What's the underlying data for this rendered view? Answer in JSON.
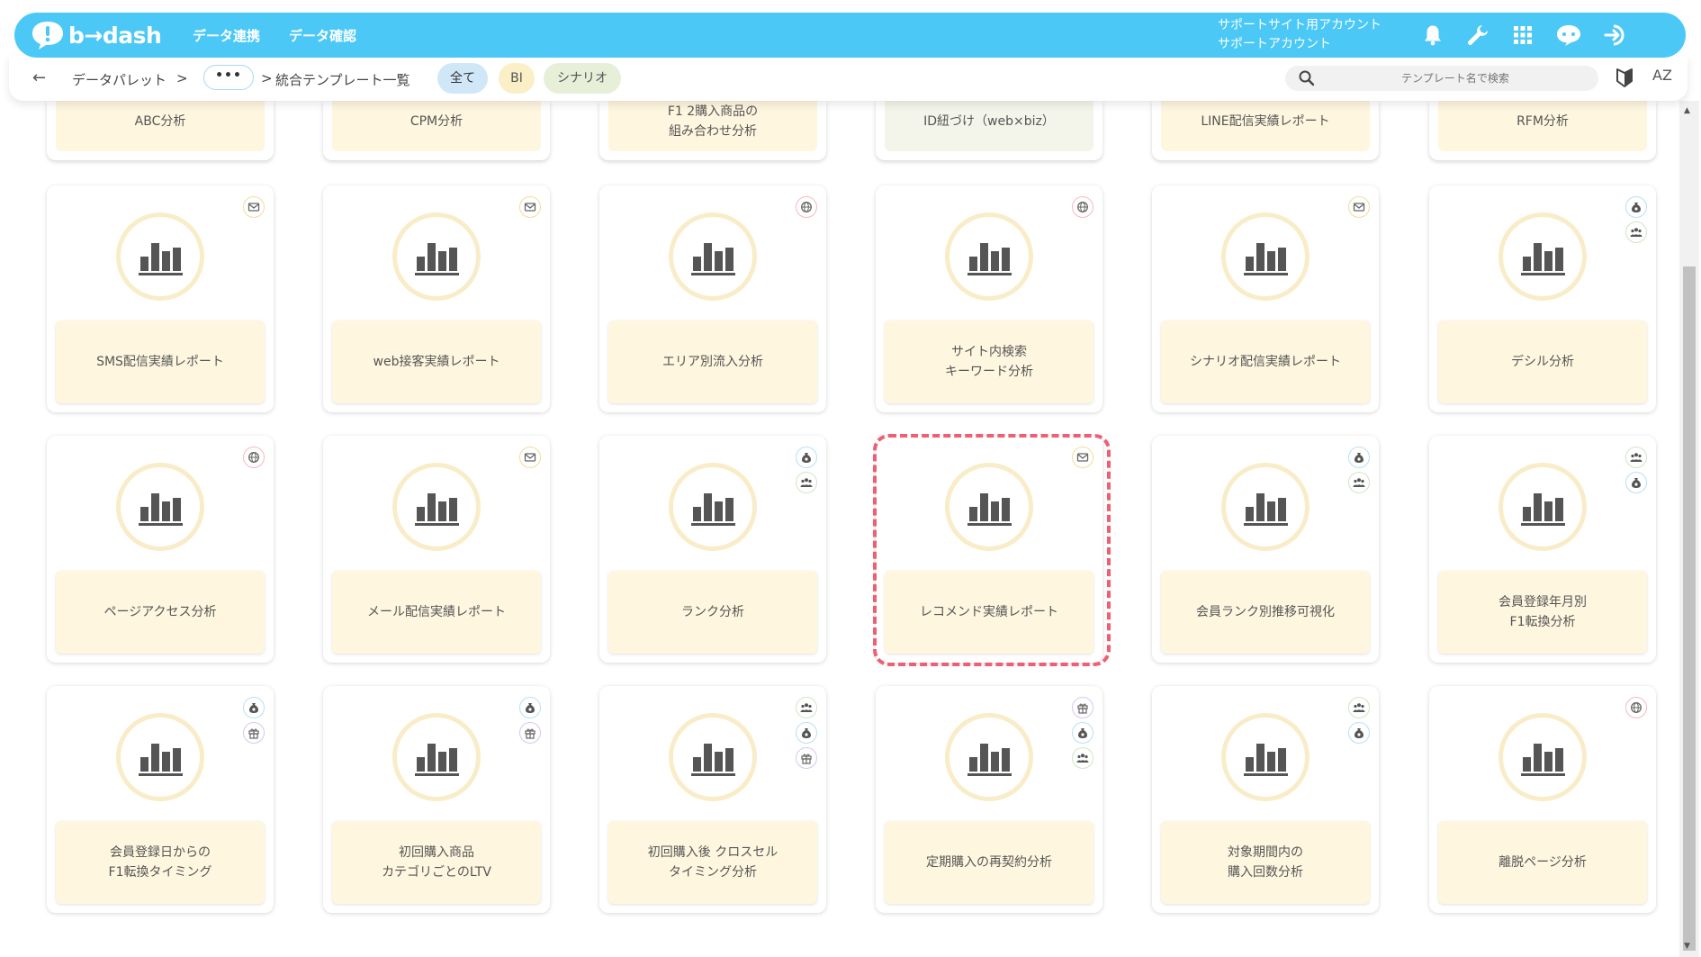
{
  "header": {
    "logo_text": "b→dash",
    "nav": [
      "データ連携",
      "データ確認"
    ],
    "account_line1": "サポートサイト用アカウント",
    "account_line2": "サポートアカウント"
  },
  "breadcrumb": {
    "item1": "データパレット",
    "sep": ">",
    "more": "•••",
    "current": "統合テンプレート一覧"
  },
  "tabs": [
    "全て",
    "BI",
    "シナリオ"
  ],
  "search": {
    "placeholder": "テンプレート名で検索"
  },
  "sort_label": "AZ",
  "partial_row": [
    {
      "label": "ABC分析"
    },
    {
      "label": "CPM分析"
    },
    {
      "label": "F1 2購入商品の\n組み合わせ分析"
    },
    {
      "label": "ID紐づけ（web×biz）"
    },
    {
      "label": "LINE配信実績レポート"
    },
    {
      "label": "RFM分析"
    }
  ],
  "cards": [
    {
      "label": "SMS配信実績レポート",
      "badges": [
        "mail-icon"
      ]
    },
    {
      "label": "web接客実績レポート",
      "badges": [
        "mail-icon"
      ]
    },
    {
      "label": "エリア別流入分析",
      "badges": [
        "web-icon"
      ]
    },
    {
      "label": "サイト内検索\nキーワード分析",
      "badges": [
        "web-icon"
      ]
    },
    {
      "label": "シナリオ配信実績レポート",
      "badges": [
        "mail-icon"
      ]
    },
    {
      "label": "デシル分析",
      "badges": [
        "coin-icon",
        "people-icon"
      ]
    },
    {
      "label": "ページアクセス分析",
      "badges": [
        "web-icon"
      ]
    },
    {
      "label": "メール配信実績レポート",
      "badges": [
        "mail-icon"
      ]
    },
    {
      "label": "ランク分析",
      "badges": [
        "coin-icon",
        "people-icon"
      ]
    },
    {
      "label": "レコメンド実績レポート",
      "badges": [
        "mail-icon"
      ]
    },
    {
      "label": "会員ランク別推移可視化",
      "badges": [
        "coin-icon",
        "people-icon"
      ]
    },
    {
      "label": "会員登録年月別\nF1転換分析",
      "badges": [
        "people-icon",
        "coin-icon"
      ]
    },
    {
      "label": "会員登録日からの\nF1転換タイミング",
      "badges": [
        "coin-icon",
        "gift-icon"
      ]
    },
    {
      "label": "初回購入商品\nカテゴリごとのLTV",
      "badges": [
        "coin-icon",
        "gift-icon"
      ]
    },
    {
      "label": "初回購入後 クロスセル\nタイミング分析",
      "badges": [
        "people-icon",
        "coin-icon",
        "gift-icon"
      ]
    },
    {
      "label": "定期購入の再契約分析",
      "badges": [
        "gift-icon",
        "coin-icon",
        "people-icon"
      ]
    },
    {
      "label": "対象期間内の\n購入回数分析",
      "badges": [
        "people-icon",
        "coin-icon"
      ]
    },
    {
      "label": "離脱ページ分析",
      "badges": [
        "web-icon"
      ]
    }
  ],
  "colors": {
    "header_bg": "#4cc8f6",
    "card_label_bg": "#fef6df",
    "icon_circle": "#f9ecc8",
    "highlight": "#ef5f73"
  }
}
